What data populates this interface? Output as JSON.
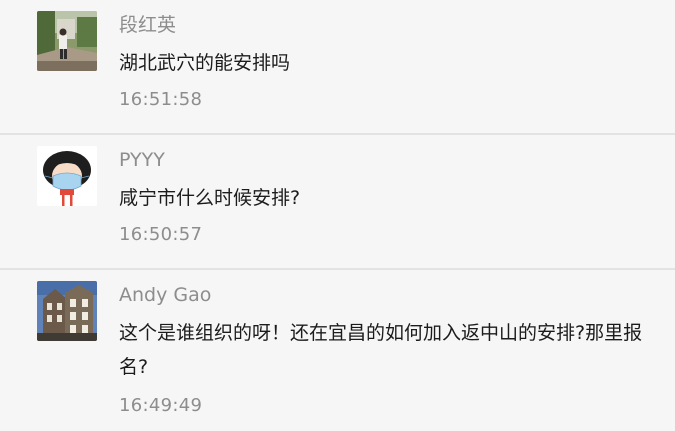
{
  "comments": [
    {
      "avatar_icon": "avatar-photo-outdoor",
      "nickname": "段红英",
      "content": "湖北武穴的能安排吗",
      "time": "16:51:58"
    },
    {
      "avatar_icon": "avatar-cartoon-girl-mask",
      "nickname": "PYYY",
      "content": "咸宁市什么时候安排?",
      "time": "16:50:57"
    },
    {
      "avatar_icon": "avatar-photo-building",
      "nickname": "Andy Gao",
      "content": "这个是谁组织的呀！还在宜昌的如何加入返中山的安排?那里报名?",
      "time": "16:49:49"
    }
  ]
}
